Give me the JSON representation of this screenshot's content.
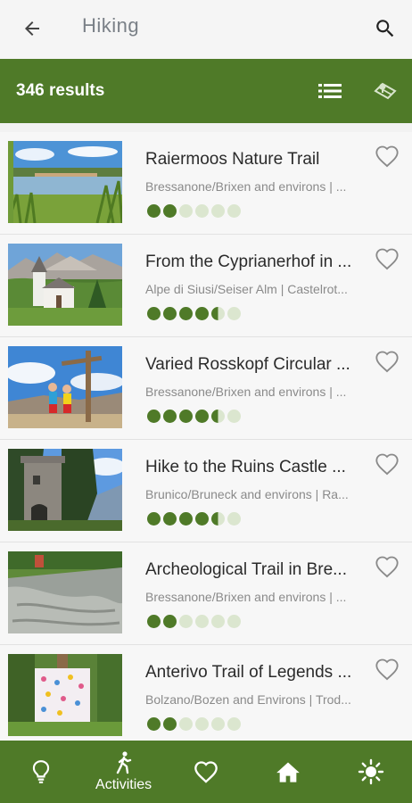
{
  "header": {
    "title": "Hiking",
    "back_icon": "arrow-left-icon",
    "search_icon": "search-icon"
  },
  "results": {
    "count_label": "346 results",
    "list_icon": "list-view-icon",
    "map_icon": "map-view-icon"
  },
  "items": [
    {
      "name": "Raiermoos Nature Trail",
      "location": "Bressanone/Brixen and environs | ...",
      "difficulty": 2,
      "difficulty_max": 6,
      "thumb": "lake-meadow"
    },
    {
      "name": "From the Cyprianerhof in ...",
      "location": "Alpe di Siusi/Seiser Alm | Castelrot...",
      "difficulty": 4.5,
      "difficulty_max": 6,
      "thumb": "chapel-dolomites"
    },
    {
      "name": "Varied Rosskopf Circular ...",
      "location": "Bressanone/Brixen and environs | ...",
      "difficulty": 4.5,
      "difficulty_max": 6,
      "thumb": "summit-cross"
    },
    {
      "name": "Hike to the Ruins Castle ...",
      "location": "Brunico/Bruneck and environs | Ra...",
      "difficulty": 4.5,
      "difficulty_max": 6,
      "thumb": "castle-ruins"
    },
    {
      "name": "Archeological Trail in Bre...",
      "location": "Bressanone/Brixen and environs | ...",
      "difficulty": 2,
      "difficulty_max": 6,
      "thumb": "rock-slabs"
    },
    {
      "name": "Anterivo Trail of Legends ...",
      "location": "Bolzano/Bozen and Environs | Trod...",
      "difficulty": 2,
      "difficulty_max": 6,
      "thumb": "forest-banner"
    }
  ],
  "nav": [
    {
      "icon": "lightbulb-icon",
      "label": ""
    },
    {
      "icon": "hiker-icon",
      "label": "Activities"
    },
    {
      "icon": "heart-icon",
      "label": ""
    },
    {
      "icon": "home-icon",
      "label": ""
    },
    {
      "icon": "sun-icon",
      "label": ""
    }
  ],
  "colors": {
    "accent": "#4f7a28",
    "dot_empty": "#dbe6cf"
  }
}
